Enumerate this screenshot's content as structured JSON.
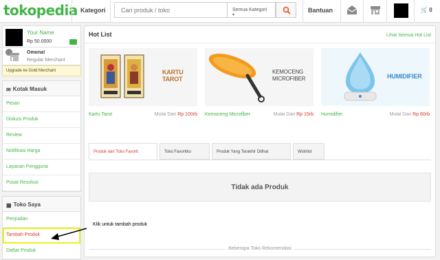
{
  "header": {
    "logo": "tokopedia",
    "kategori_label": "Kategori",
    "search_placeholder": "Cari produk / toko",
    "category_select": "Semua Kategori",
    "bantuan_label": "Bantuan",
    "cart_count": "0",
    "icons": [
      "message-icon",
      "shop-icon",
      "avatar",
      "cart-icon"
    ]
  },
  "sidebar": {
    "user_name": "Your Name",
    "balance": "Rp 50.0000",
    "shop_name": "Omona!",
    "shop_type": "Regular Merchant",
    "upgrade_label": "Upgrade ke Gold Merchant",
    "inbox": {
      "title": "Kotak Masuk",
      "items": [
        "Pesan",
        "Diskusi Produk",
        "Review",
        "Notifikasi Harga",
        "Layanan Pengguna",
        "Pusat Resolusi"
      ]
    },
    "myshop": {
      "title": "Toko Saya",
      "items": [
        "Penjualan",
        "Tambah Produk",
        "Daftar Produk"
      ]
    }
  },
  "main": {
    "hot_title": "Hot List",
    "hot_link": "Lihat Semua Hot List",
    "products": [
      {
        "banner": "KARTU TAROT",
        "name": "Kartu Tarot",
        "price_prefix": "Mulai Dari",
        "price": "Rp 100rb"
      },
      {
        "banner": "KEMOCENG MICROFIBER",
        "name": "Kemoceng Microfiber",
        "price_prefix": "Mulai Dari",
        "price": "Rp 15rb"
      },
      {
        "banner": "HUMIDIFIER",
        "name": "Humidifier",
        "price_prefix": "Mulai Dari",
        "price": "Rp 80rb"
      }
    ],
    "tabs": [
      "Produk dari Toko Favorit",
      "Toko Favoritku",
      "Produk Yang Terakhir Dilihat",
      "Wishlist"
    ],
    "active_tab": "Produk dari Toko Favorit",
    "empty_message": "Tidak ada Produk",
    "recommend_label": "Beberapa Toko Rekomendasi"
  },
  "annotation": {
    "text": "Klik untuk tambah produk"
  },
  "colors": {
    "brand_green": "#42b549",
    "price_red": "#d63a2c",
    "highlight_yellow": "#e9f21a"
  }
}
